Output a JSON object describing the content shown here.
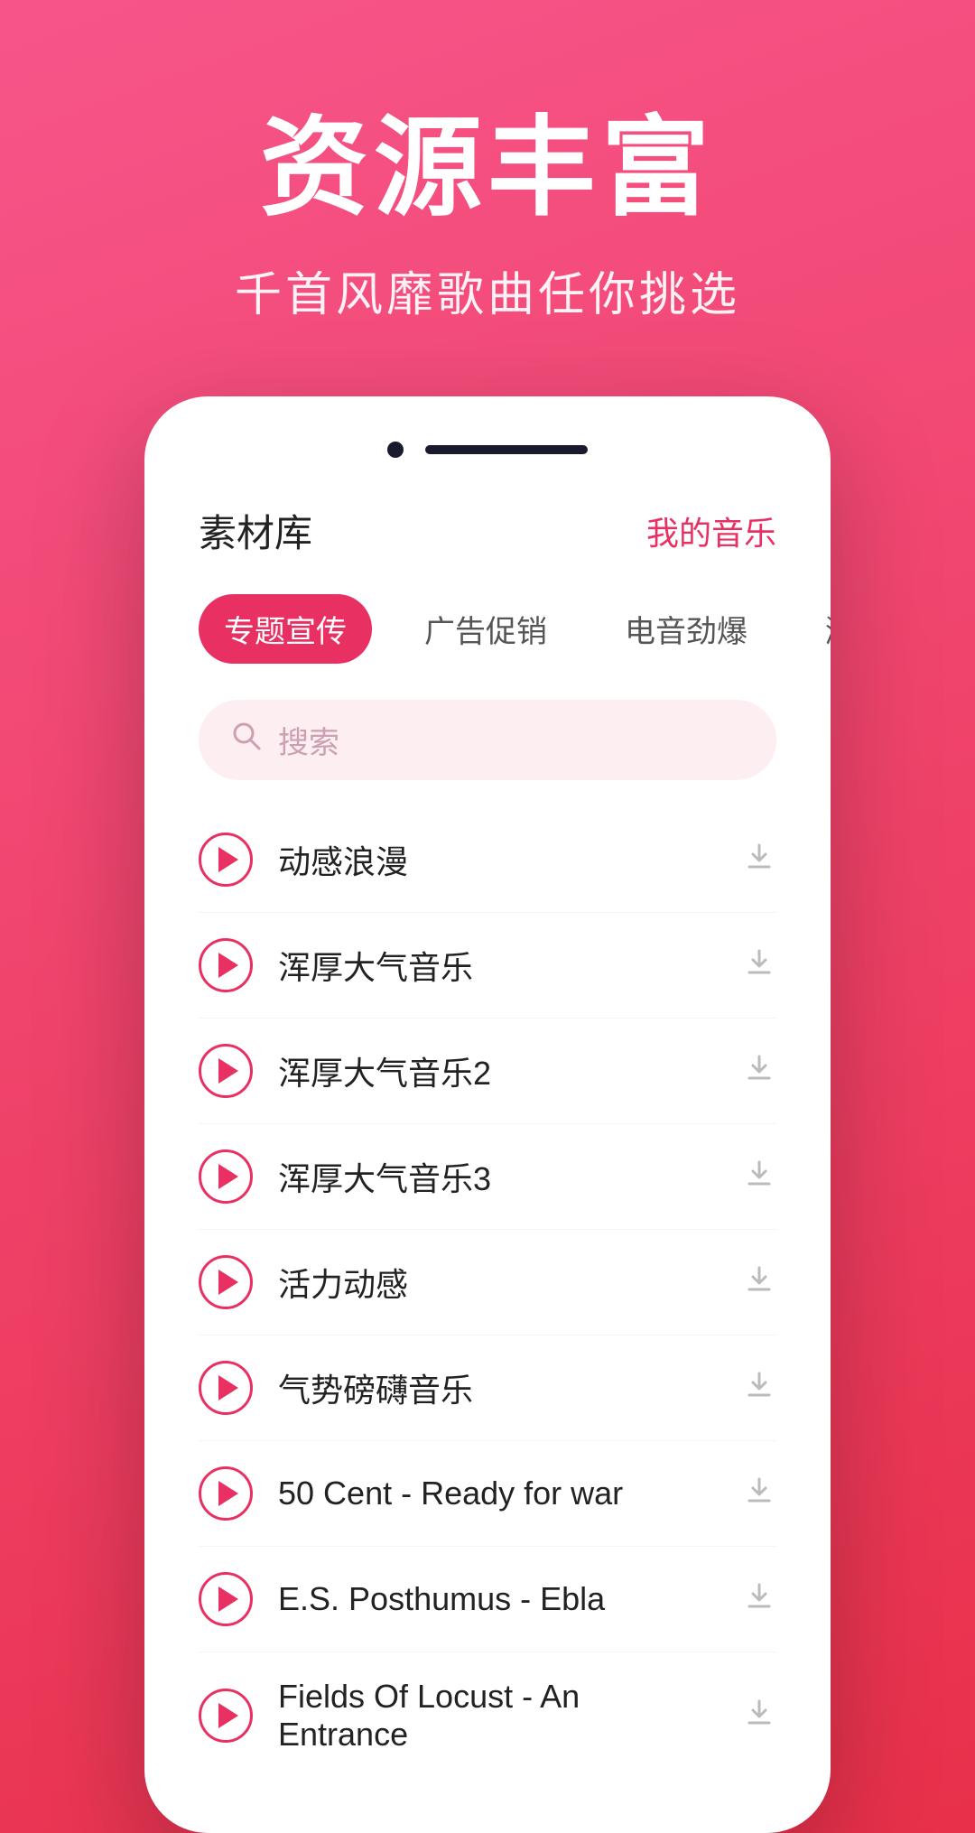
{
  "hero": {
    "title": "资源丰富",
    "subtitle": "千首风靡歌曲任你挑选"
  },
  "phone": {
    "library_title": "素材库",
    "my_music_label": "我的音乐",
    "tabs": [
      {
        "label": "专题宣传",
        "active": true
      },
      {
        "label": "广告促销",
        "active": false
      },
      {
        "label": "电音劲爆",
        "active": false
      },
      {
        "label": "激情磅礴",
        "active": false
      }
    ],
    "search": {
      "placeholder": "搜索"
    },
    "music_items": [
      {
        "name": "动感浪漫"
      },
      {
        "name": "浑厚大气音乐"
      },
      {
        "name": "浑厚大气音乐2"
      },
      {
        "name": "浑厚大气音乐3"
      },
      {
        "name": "活力动感"
      },
      {
        "name": "气势磅礴音乐"
      },
      {
        "name": "50 Cent - Ready for war"
      },
      {
        "name": "E.S. Posthumus - Ebla"
      },
      {
        "name": "Fields Of Locust - An Entrance"
      }
    ]
  },
  "colors": {
    "accent": "#e83062",
    "bg_gradient_start": "#f7558a",
    "bg_gradient_end": "#e8304a"
  }
}
